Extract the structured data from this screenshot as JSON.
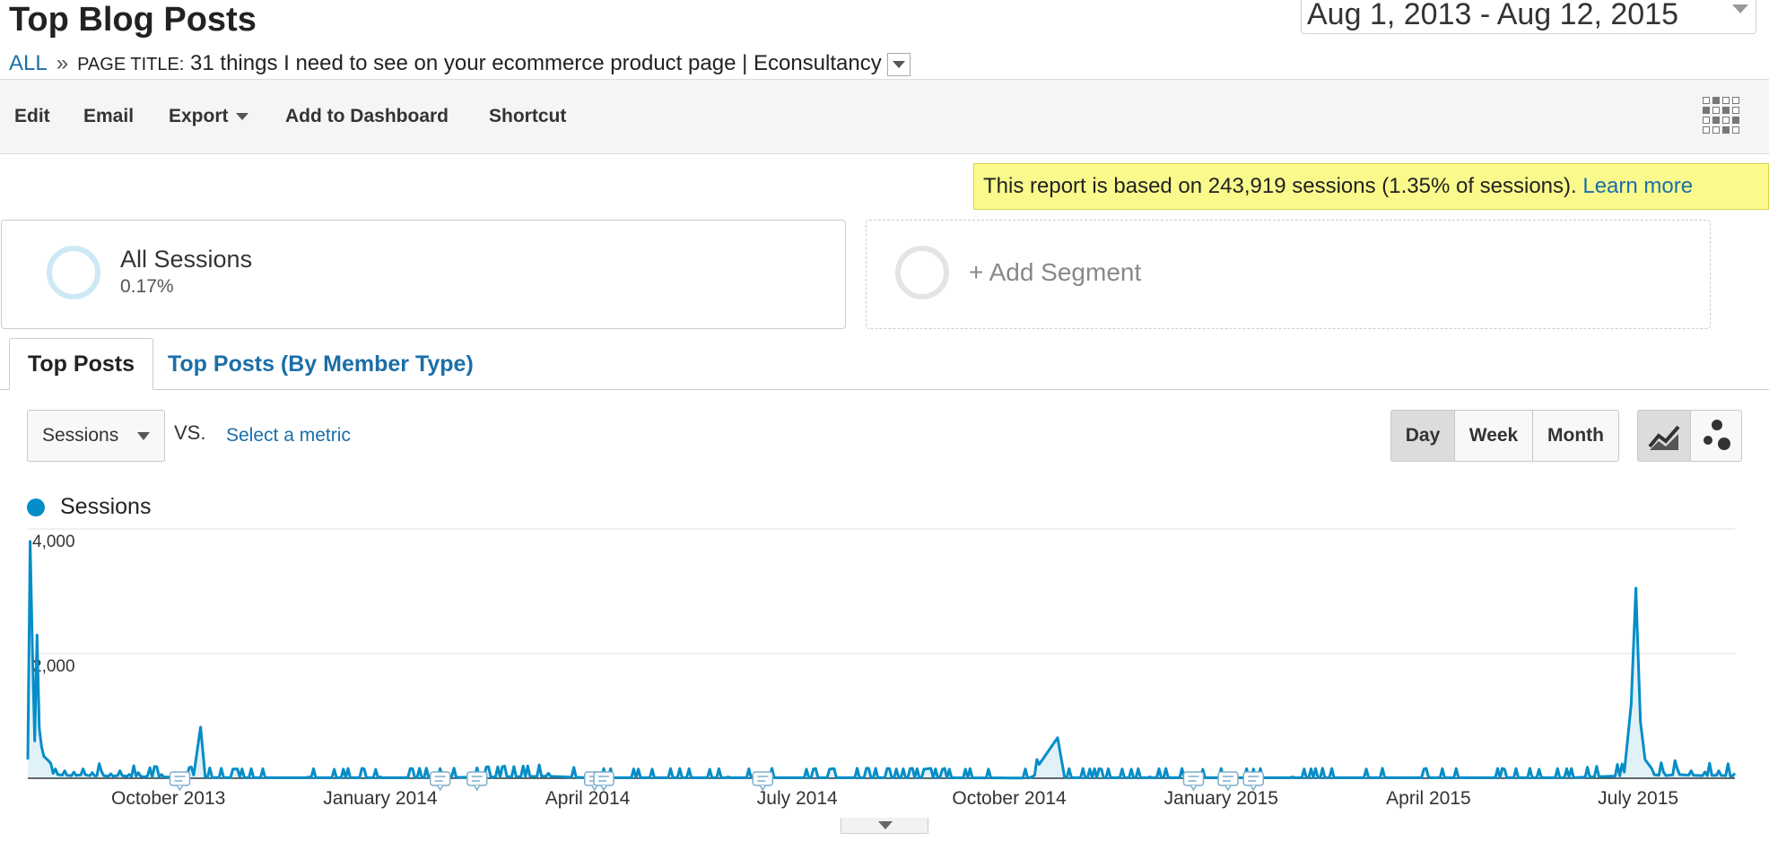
{
  "header": {
    "title": "Top Blog Posts",
    "date_range": "Aug 1, 2013 - Aug 12, 2015"
  },
  "breadcrumb": {
    "all": "ALL",
    "separator": "»",
    "label": "PAGE TITLE:",
    "page_title": "31 things I need to see on your ecommerce product page | Econsultancy"
  },
  "toolbar": {
    "edit": "Edit",
    "email": "Email",
    "export": "Export",
    "add_to_dashboard": "Add to Dashboard",
    "shortcut": "Shortcut"
  },
  "notice": {
    "text": "This report is based on 243,919 sessions (1.35% of sessions). ",
    "link": "Learn more",
    "background": "#fafa8c"
  },
  "segments": {
    "primary_name": "All Sessions",
    "primary_percent": "0.17%",
    "add_label": "+ Add Segment"
  },
  "tabs": [
    "Top Posts",
    "Top Posts (By Member Type)"
  ],
  "metric": {
    "selected": "Sessions",
    "vs": "VS.",
    "select_link": "Select a metric"
  },
  "granularity": [
    "Day",
    "Week",
    "Month"
  ],
  "chart_view_icons": [
    "line-chart-icon",
    "motion-chart-icon"
  ],
  "colors": {
    "series": "#058dc7",
    "link": "#1a6fa8"
  },
  "chart_data": {
    "type": "line",
    "title": "",
    "series": [
      {
        "name": "Sessions"
      }
    ],
    "xlabel": "",
    "ylabel": "",
    "ylim": [
      0,
      4000
    ],
    "yticks": [
      "2,000",
      "4,000"
    ],
    "xlim": [
      "2013-08-01",
      "2015-08-12"
    ],
    "xticks": [
      "October 2013",
      "January 2014",
      "April 2014",
      "July 2014",
      "October 2014",
      "January 2015",
      "April 2015",
      "July 2015"
    ],
    "legend": "top-left",
    "grid": true,
    "points": [
      [
        "2013-08-01",
        300
      ],
      [
        "2013-08-02",
        3800
      ],
      [
        "2013-08-03",
        2100
      ],
      [
        "2013-08-04",
        600
      ],
      [
        "2013-08-05",
        2300
      ],
      [
        "2013-08-06",
        800
      ],
      [
        "2013-08-07",
        500
      ],
      [
        "2013-08-08",
        350
      ],
      [
        "2013-08-10",
        280
      ],
      [
        "2013-08-13",
        150
      ],
      [
        "2013-08-17",
        120
      ],
      [
        "2013-08-21",
        100
      ],
      [
        "2013-08-25",
        150
      ],
      [
        "2013-08-29",
        90
      ],
      [
        "2013-09-02",
        110
      ],
      [
        "2013-09-06",
        70
      ],
      [
        "2013-09-10",
        120
      ],
      [
        "2013-09-14",
        60
      ],
      [
        "2013-09-18",
        90
      ],
      [
        "2013-09-22",
        40
      ],
      [
        "2013-09-28",
        60
      ],
      [
        "2013-10-05",
        30
      ],
      [
        "2013-10-12",
        50
      ],
      [
        "2013-10-15",
        820
      ],
      [
        "2013-10-17",
        30
      ],
      [
        "2013-11-01",
        20
      ],
      [
        "2013-12-01",
        20
      ],
      [
        "2014-01-01",
        20
      ],
      [
        "2014-02-01",
        30
      ],
      [
        "2014-03-15",
        80
      ],
      [
        "2014-04-01",
        20
      ],
      [
        "2014-06-01",
        20
      ],
      [
        "2014-09-01",
        20
      ],
      [
        "2014-10-10",
        10
      ],
      [
        "2014-10-22",
        650
      ],
      [
        "2014-10-25",
        20
      ],
      [
        "2014-12-01",
        20
      ],
      [
        "2015-02-01",
        20
      ],
      [
        "2015-04-01",
        20
      ],
      [
        "2015-06-01",
        20
      ],
      [
        "2015-06-25",
        100
      ],
      [
        "2015-06-28",
        1200
      ],
      [
        "2015-06-30",
        3050
      ],
      [
        "2015-07-02",
        900
      ],
      [
        "2015-07-04",
        300
      ],
      [
        "2015-07-07",
        150
      ],
      [
        "2015-07-12",
        100
      ],
      [
        "2015-07-18",
        150
      ],
      [
        "2015-07-24",
        120
      ],
      [
        "2015-07-30",
        100
      ],
      [
        "2015-08-05",
        120
      ],
      [
        "2015-08-12",
        80
      ]
    ],
    "annotations": [
      "2013-10-06",
      "2014-01-27",
      "2014-02-12",
      "2014-04-04",
      "2014-04-08",
      "2014-06-16",
      "2014-12-20",
      "2015-01-04",
      "2015-01-15"
    ]
  }
}
